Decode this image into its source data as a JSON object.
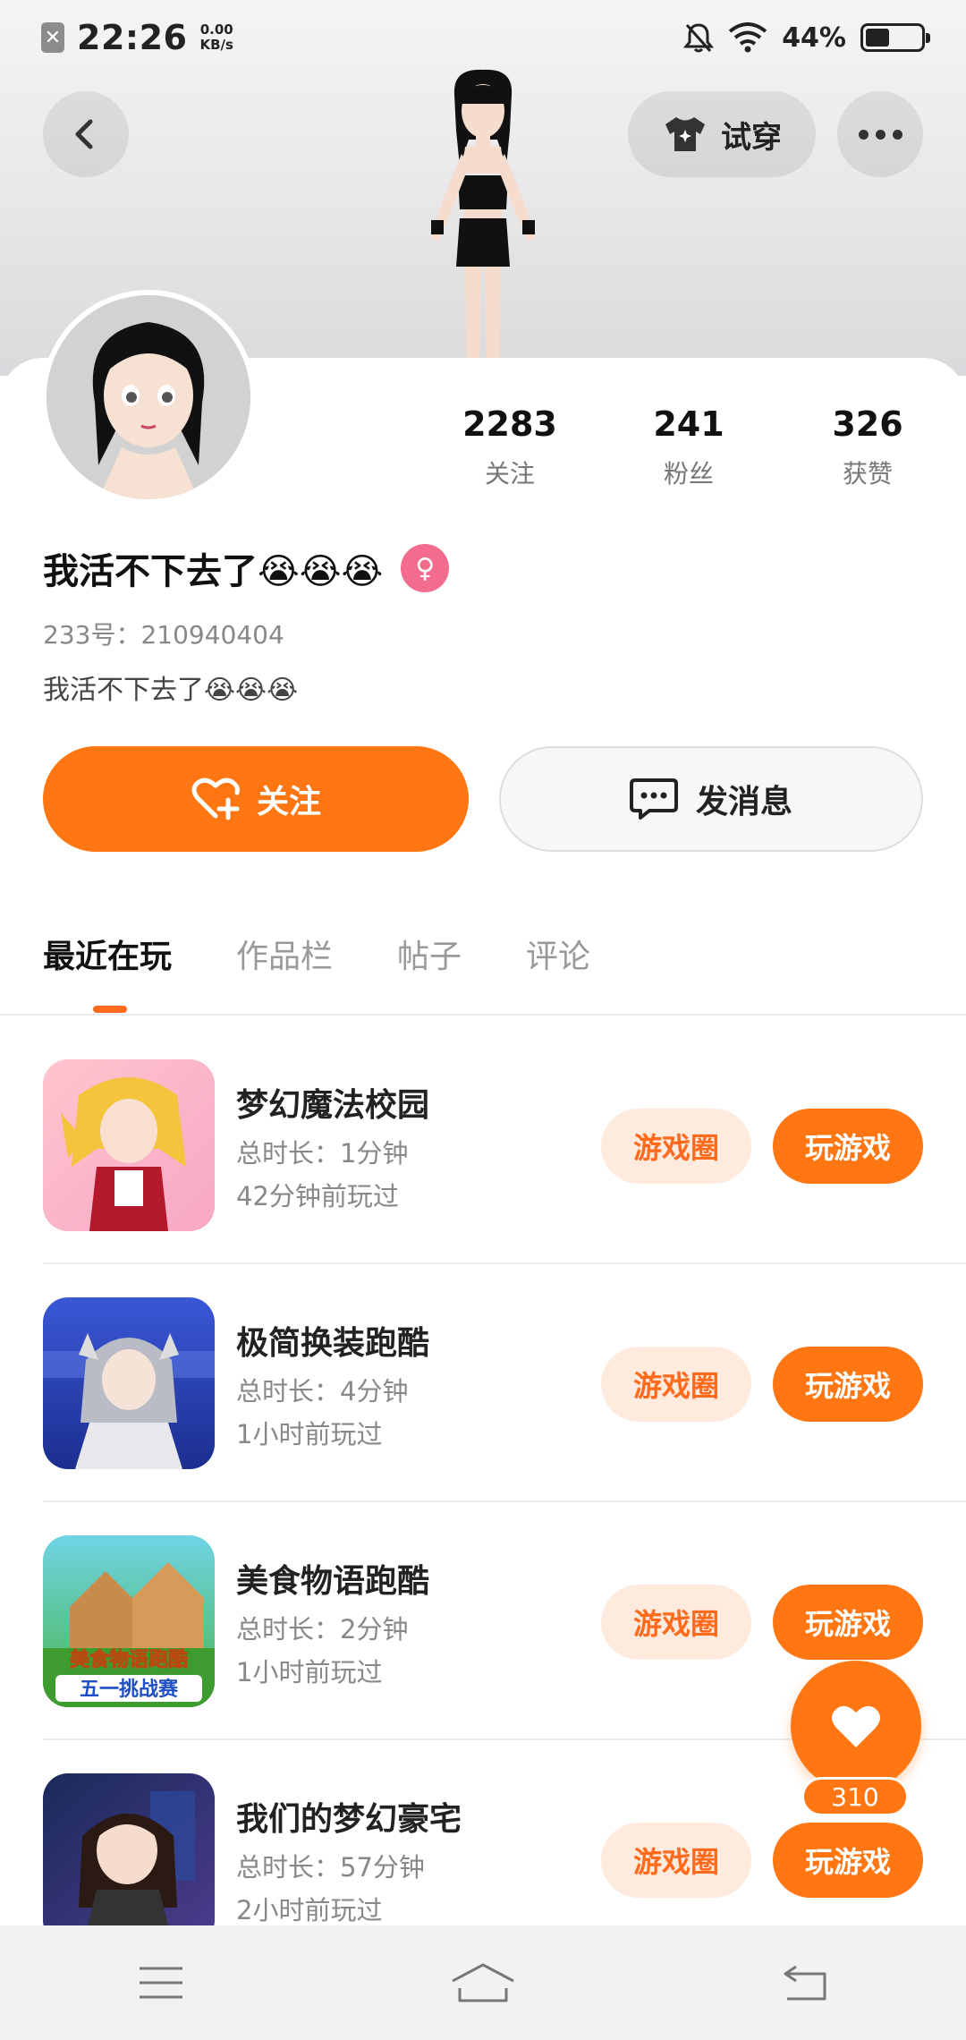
{
  "status_bar": {
    "time": "22:26",
    "speed_value": "0.00",
    "speed_unit": "KB/s",
    "battery_percent_text": "44%",
    "battery_level": 0.44
  },
  "header": {
    "try_on_label": "试穿"
  },
  "profile": {
    "following_count": "2283",
    "following_label": "关注",
    "fans_count": "241",
    "fans_label": "粉丝",
    "likes_count": "326",
    "likes_label": "获赞",
    "nickname": "我活不下去了😭😭😭",
    "gender_symbol": "♀",
    "uid": "233号：210940404",
    "bio": "我活不下去了😭😭😭"
  },
  "actions": {
    "follow_label": "关注",
    "message_label": "发消息"
  },
  "tabs": [
    {
      "label": "最近在玩"
    },
    {
      "label": "作品栏"
    },
    {
      "label": "帖子"
    },
    {
      "label": "评论"
    }
  ],
  "games": [
    {
      "title": "梦幻魔法校园",
      "duration": "总时长：1分钟",
      "last_played": "42分钟前玩过",
      "circle_label": "游戏圈",
      "play_label": "玩游戏"
    },
    {
      "title": "极简换装跑酷",
      "duration": "总时长：4分钟",
      "last_played": "1小时前玩过",
      "circle_label": "游戏圈",
      "play_label": "玩游戏"
    },
    {
      "title": "美食物语跑酷",
      "duration": "总时长：2分钟",
      "last_played": "1小时前玩过",
      "circle_label": "游戏圈",
      "play_label": "玩游戏",
      "thumb_line1": "美食物语跑酷",
      "thumb_line2": "五一挑战赛"
    },
    {
      "title": "我们的梦幻豪宅",
      "duration": "总时长：57分钟",
      "last_played": "2小时前玩过",
      "circle_label": "游戏圈",
      "play_label": "玩游戏"
    }
  ],
  "fab": {
    "count": "310"
  },
  "colors": {
    "accent": "#ff7613",
    "accent_light": "#ffeade",
    "gender_badge": "#f36c8e"
  },
  "icons": [
    "close-notification-icon",
    "mute-bell-icon",
    "wifi-icon",
    "battery-icon",
    "back-arrow-icon",
    "shirt-icon",
    "more-dots-icon",
    "heart-plus-icon",
    "chat-bubble-icon",
    "heart-icon",
    "menu-icon",
    "home-icon",
    "return-icon"
  ]
}
